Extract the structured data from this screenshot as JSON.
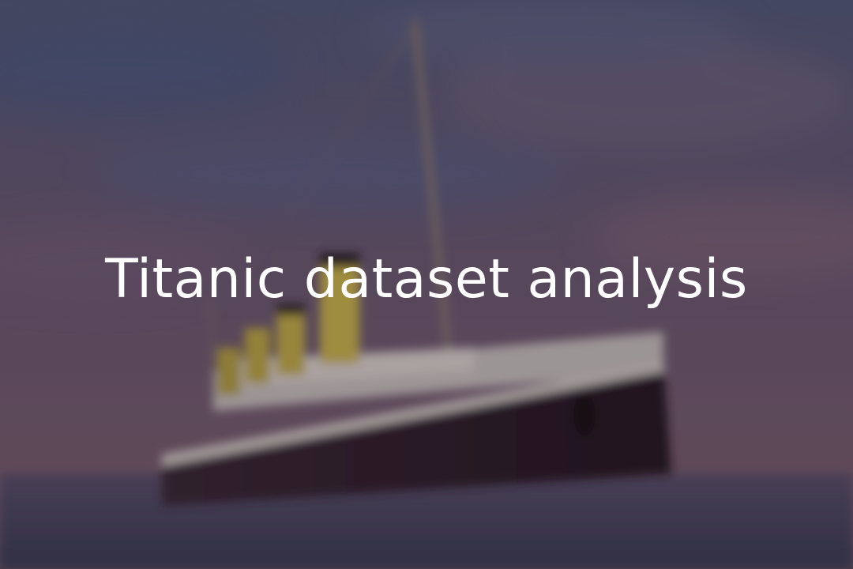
{
  "title": "Titanic dataset analysis",
  "background": {
    "icon": "ship-photo",
    "sky_top": "#545a78",
    "sky_mid": "#6e5a70",
    "sky_horizon": "#7b5e6c",
    "sea": "#4a4a5e",
    "hull": "#2a1820",
    "funnel": "#b9a43c",
    "overlay": "#1a1428"
  }
}
